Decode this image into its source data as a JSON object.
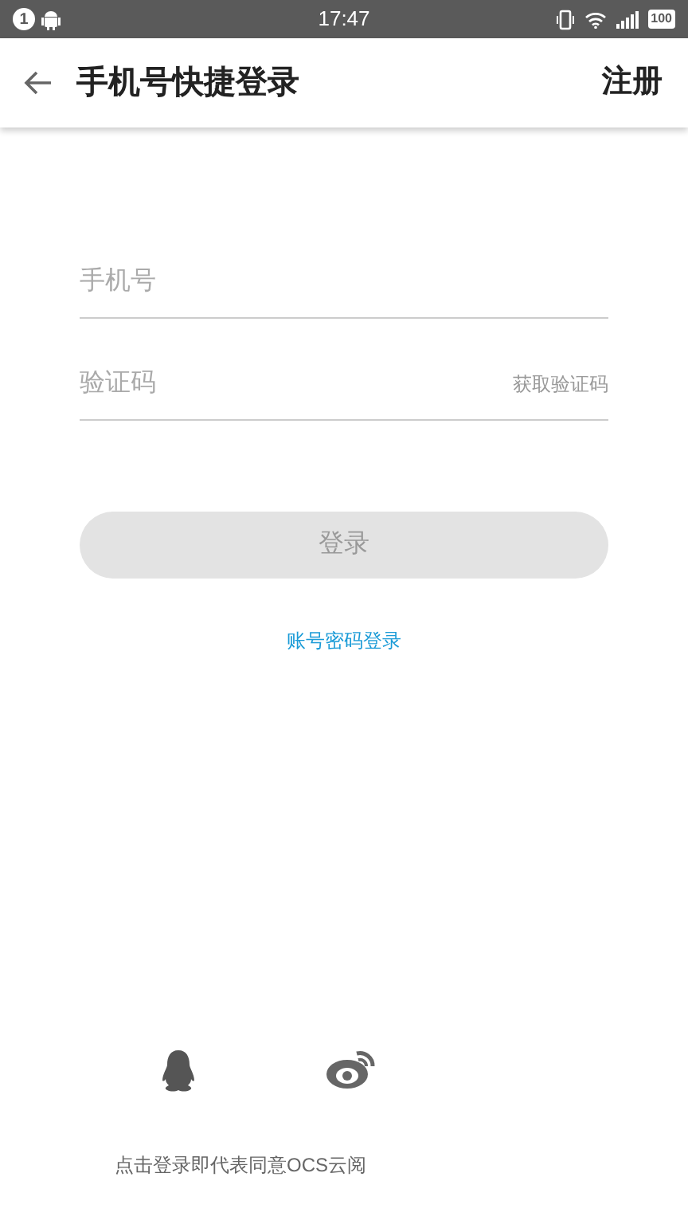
{
  "status_bar": {
    "notification_count": "1",
    "time": "17:47",
    "battery": "100"
  },
  "header": {
    "title": "手机号快捷登录",
    "action": "注册"
  },
  "form": {
    "phone": {
      "placeholder": "手机号"
    },
    "code": {
      "placeholder": "验证码",
      "action": "获取验证码"
    },
    "submit": {
      "label": "登录",
      "disabled": true
    },
    "alt_login": "账号密码登录"
  },
  "terms": "点击登录即代表同意OCS云阅"
}
